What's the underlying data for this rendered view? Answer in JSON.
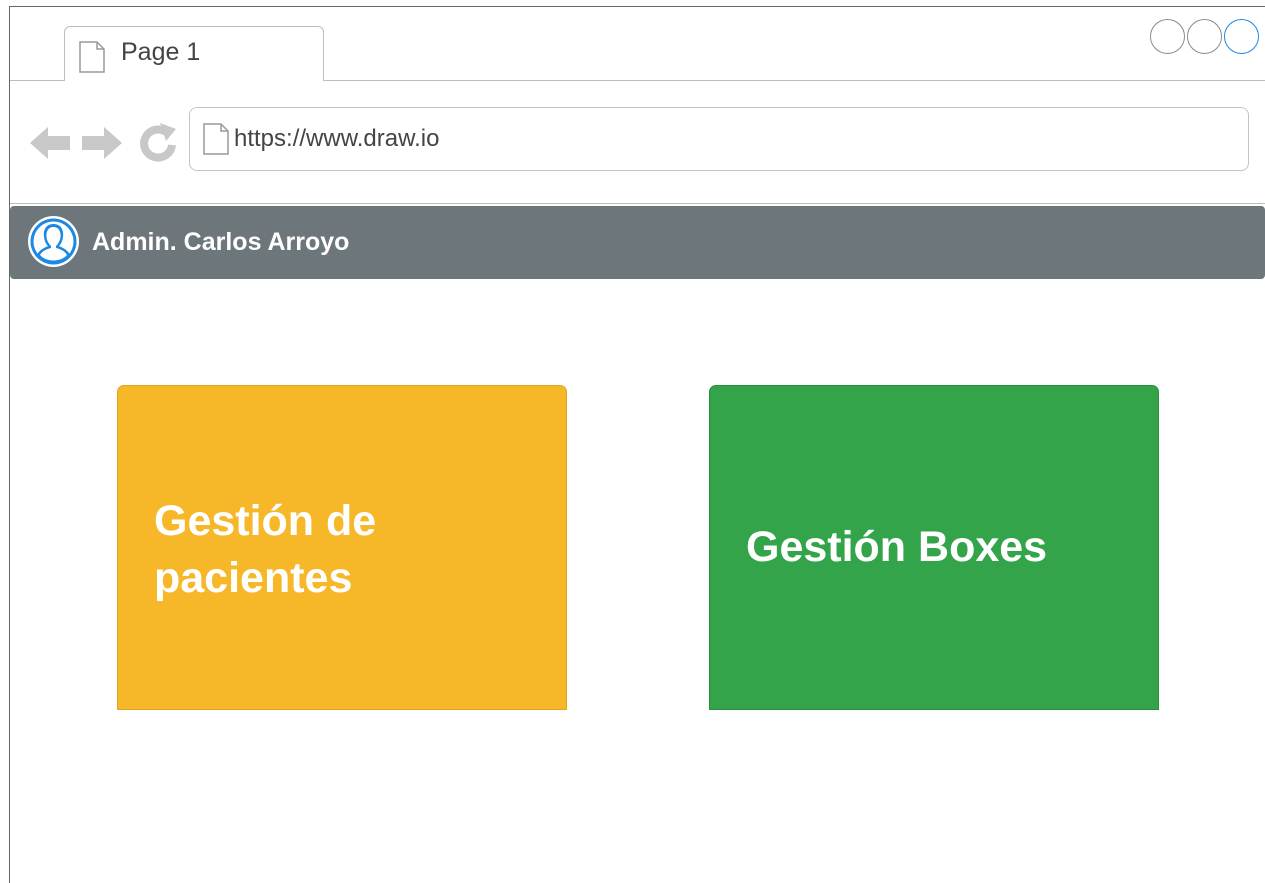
{
  "browser": {
    "tab_label": "Page 1",
    "url": "https://www.draw.io",
    "accent_color": "#1e88e5"
  },
  "header": {
    "admin_name": "Admin. Carlos Arroyo",
    "background_color": "#6d767b"
  },
  "cards": [
    {
      "label": "Gestión de pacientes",
      "color": "#f6b729"
    },
    {
      "label": "Gestión Boxes",
      "color": "#33a44a"
    }
  ],
  "icons": [
    "page-icon",
    "back-arrow-icon",
    "forward-arrow-icon",
    "reload-icon",
    "user-avatar-icon"
  ]
}
